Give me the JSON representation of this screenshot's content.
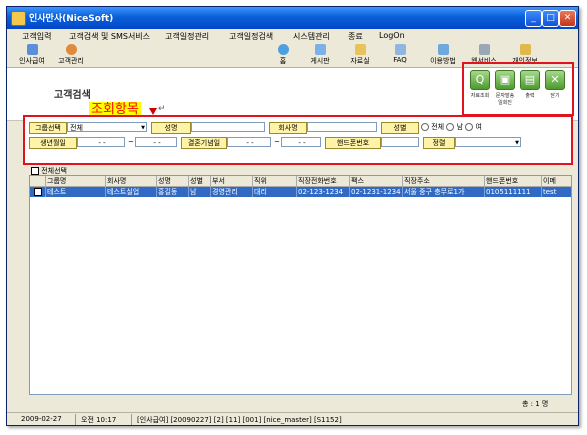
{
  "window": {
    "title": "인사만사(NiceSoft)"
  },
  "menu": [
    "고객입력",
    "고객검색 및 SMS서비스",
    "고객일정관리",
    "고객일정검색",
    "시스템관리",
    "종료",
    "LogOn"
  ],
  "toolbar": {
    "left": [
      "인사급여",
      "고객관리"
    ],
    "right": [
      "홈",
      "게시판",
      "자료실",
      "FAQ",
      "이용방법",
      "웹서비스",
      "개인정보"
    ]
  },
  "page": {
    "title": "고객검색",
    "query_toggle": "조회항목",
    "return_glyph": "↵"
  },
  "actions": [
    {
      "label": "자료조회",
      "glyph": "Q"
    },
    {
      "label": "문자발송 일회진",
      "glyph": "▣"
    },
    {
      "label": "출력",
      "glyph": "▤"
    },
    {
      "label": "닫기",
      "glyph": "✕"
    }
  ],
  "search": {
    "group_label": "그룹선택",
    "group_value": "전체",
    "name_label": "성명",
    "name_value": "",
    "company_label": "회사명",
    "company_value": "",
    "gender_label": "성별",
    "gender_options": [
      "전체",
      "남",
      "여"
    ],
    "birthday_label": "생년월일",
    "birthday_from": "-  -",
    "birthday_to": "-  -",
    "range_sep": "~",
    "anniv_label": "결혼기념일",
    "anniv_from": "-  -",
    "anniv_to": "-  -",
    "phone_label": "핸드폰번호",
    "phone_value": "",
    "sort_label": "정렬",
    "sort_value": ""
  },
  "grid": {
    "select_all": "전체선택",
    "columns": [
      "그룹명",
      "회사명",
      "성명",
      "성별",
      "부서",
      "직위",
      "직장전화번호",
      "팩스",
      "직장주소",
      "핸드폰번호",
      "이메"
    ],
    "rows": [
      [
        "테스트",
        "테스트실업",
        "홍길동",
        "남",
        "경영관리",
        "대리",
        "02-123-1234",
        "02-1231-1234",
        "서울 중구 충무로1가",
        "0105111111",
        "test"
      ]
    ]
  },
  "total_count": "총 : 1 명",
  "status": {
    "date": "2009-02-27",
    "time": "오전 10:17",
    "info": "[인사급여] [20090227] [2] [11] [001] [nice_master] [S1152]"
  },
  "colors": {
    "highlight": "#e0141e",
    "selected_row": "#316ac5",
    "title_bar": "#0a5fd8",
    "label_bg": "#fff3a8"
  }
}
